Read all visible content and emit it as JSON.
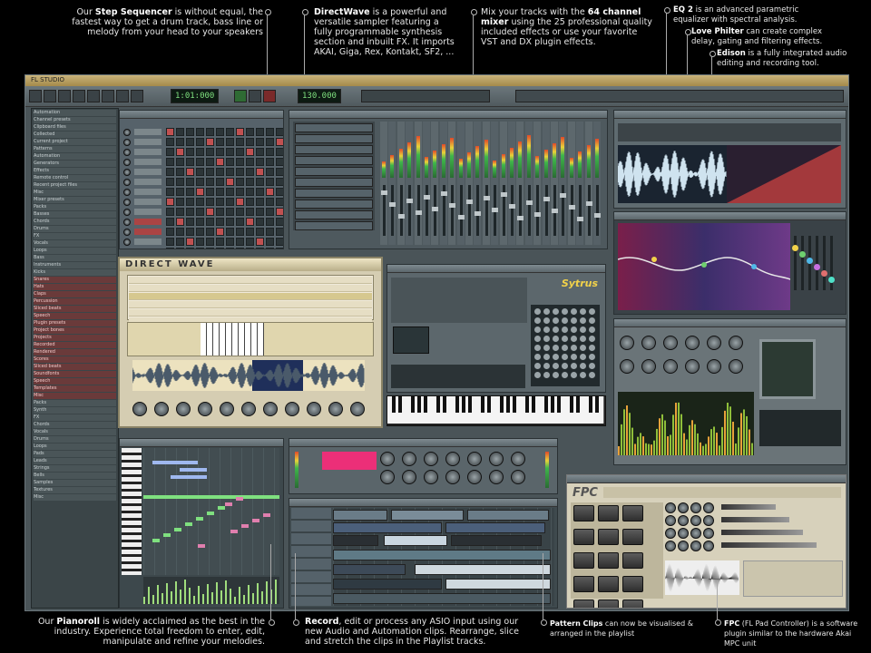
{
  "captions": {
    "step_sequencer": {
      "pre": "Our ",
      "bold": "Step Sequencer",
      "post": " is without equal, the fastest way to get a drum track, bass line or melody from your head to your speakers"
    },
    "directwave": {
      "bold": "DirectWave",
      "post": " is a powerful and versatile sampler featuring a fully programmable synthesis section and inbuilt FX. It imports AKAI, Giga, Rex, Kontakt, SF2, ..."
    },
    "mixer": {
      "pre": "Mix your tracks with the ",
      "bold": "64 channel mixer",
      "post": " using the 25 professional quality included effects or use your favorite VST and DX plugin effects."
    },
    "eq2": {
      "bold": "EQ 2",
      "post": " is an advanced parametric equalizer with spectral analysis."
    },
    "love_philter": {
      "bold": "Love Philter",
      "post": " can create complex delay, gating and filtering effects."
    },
    "edison": {
      "bold": "Edison",
      "post": " is a fully integrated audio editing and recording tool."
    },
    "pianoroll": {
      "pre": "Our ",
      "bold": "Pianoroll",
      "post": " is widely acclaimed as the best in the industry. Experience total freedom to enter, edit, manipulate and refine your melodies."
    },
    "record": {
      "bold": "Record",
      "post": ", edit or process any ASIO input using our new Audio and Automation clips. Rearrange, slice and stretch the clips in the Playlist tracks."
    },
    "pattern_clips": {
      "bold": "Pattern Clips",
      "post": " can now be visualised & arranged in the playlist"
    },
    "fpc": {
      "bold": "FPC",
      "post": " (FL Pad Controller) is a software plugin similar to the hardware Akai MPC unit"
    }
  },
  "app": {
    "title": "FL STUDIO",
    "time_display": "1:01:000",
    "tempo_display": "130.000",
    "directwave_logo": "DIRECT WAVE",
    "fpc_logo": "FPC",
    "sytrus_logo": "Sytrus"
  },
  "browser": {
    "items": [
      "Automation",
      "Channel presets",
      "Clipboard files",
      "Collected",
      "Current project",
      "Patterns",
      "Automation",
      "Generators",
      "Effects",
      "Remote control",
      "Recent project files",
      "Misc",
      "Mixer presets",
      "Packs",
      "Basses",
      "Chords",
      "Drums",
      "FX",
      "Vocals",
      "Loops",
      "Bass",
      "Instruments",
      "Kicks",
      "Snares",
      "Hats",
      "Claps",
      "Percussion",
      "Sliced beats",
      "Speech",
      "Plugin presets",
      "Project bones",
      "Projects",
      "Recorded",
      "Rendered",
      "Scores",
      "Sliced beats",
      "Soundfonts",
      "Speech",
      "Templates",
      "Misc",
      "Packs",
      "Synth",
      "FX",
      "Chords",
      "Vocals",
      "Drums",
      "Loops",
      "Pads",
      "Leads",
      "Strings",
      "Bells",
      "Samples",
      "Textures",
      "Misc"
    ],
    "red_items": [
      23,
      24,
      25,
      26,
      27,
      28,
      29,
      30,
      31,
      32,
      33,
      34,
      35,
      36,
      37,
      38,
      39
    ]
  },
  "colors": {
    "note_green": "#7fe07f",
    "note_pink": "#e07fae",
    "note_blue": "#9fb8ef",
    "magenta": "#ec2f78"
  }
}
